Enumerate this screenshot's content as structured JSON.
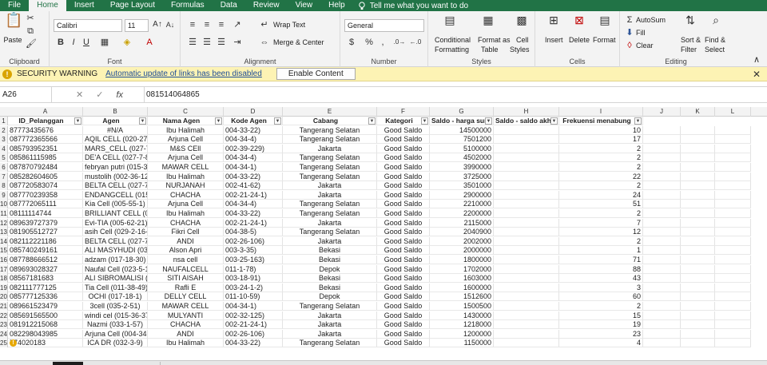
{
  "menu": {
    "tabs": [
      "File",
      "Home",
      "Insert",
      "Page Layout",
      "Formulas",
      "Data",
      "Review",
      "View",
      "Help"
    ],
    "tell_me": "Tell me what you want to do"
  },
  "ribbon": {
    "clipboard": {
      "paste": "Paste",
      "label": "Clipboard"
    },
    "font": {
      "name": "Calibri",
      "size": "11",
      "label": "Font"
    },
    "alignment": {
      "wrap": "Wrap Text",
      "merge": "Merge & Center",
      "label": "Alignment"
    },
    "number": {
      "format": "General",
      "label": "Number"
    },
    "styles": {
      "conditional_1": "Conditional",
      "conditional_2": "Formatting",
      "format_table_1": "Format as",
      "format_table_2": "Table",
      "cell_styles_1": "Cell",
      "cell_styles_2": "Styles",
      "label": "Styles"
    },
    "cells": {
      "insert": "Insert",
      "delete": "Delete",
      "format": "Format",
      "label": "Cells"
    },
    "editing": {
      "autosum": "AutoSum",
      "fill": "Fill",
      "clear": "Clear",
      "sort_1": "Sort &",
      "sort_2": "Filter",
      "find_1": "Find &",
      "find_2": "Select",
      "label": "Editing"
    }
  },
  "security": {
    "title": "SECURITY WARNING",
    "message": "Automatic update of links has been disabled",
    "button": "Enable Content"
  },
  "formula_bar": {
    "name_box": "A26",
    "fx": "fx",
    "value": "081514064865"
  },
  "grid": {
    "columns": [
      "A",
      "B",
      "C",
      "D",
      "E",
      "F",
      "G",
      "H",
      "I",
      "J",
      "K",
      "L"
    ],
    "headers": [
      "ID_Pelanggan",
      "Agen",
      "Nama Agen",
      "Kode Agen",
      "Cabang",
      "Kategori",
      "Saldo - harga sum",
      "Saldo - saldo akhir",
      "Frekuensi menabung"
    ],
    "rows": [
      {
        "n": "2",
        "a": "87773435676",
        "b": "#N/A",
        "c": "Ibu Halimah",
        "d": "004-33-22)",
        "e": "Tangerang Selatan",
        "f": "Good Saldo",
        "g": "14500000",
        "i": "10"
      },
      {
        "n": "3",
        "a": "087772365566",
        "b": "AQIL CELL (020-27-3)",
        "c": "Arjuna Cell",
        "d": "004-34-4)",
        "e": "Tangerang Selatan",
        "f": "Good Saldo",
        "g": "7501200",
        "i": "17"
      },
      {
        "n": "4",
        "a": "085793952351",
        "b": "MARS_CELL (027-7-15)",
        "c": "M&S CEll",
        "d": "002-39-229)",
        "e": "Jakarta",
        "f": "Good Saldo",
        "g": "5100000",
        "i": "2"
      },
      {
        "n": "5",
        "a": "085861115985",
        "b": "DE'A CELL (027-7-8)",
        "c": "Arjuna Cell",
        "d": "004-34-4)",
        "e": "Tangerang Selatan",
        "f": "Good Saldo",
        "g": "4502000",
        "i": "2"
      },
      {
        "n": "6",
        "a": "087870792484",
        "b": "febryan putri (015-38-22",
        "c": "MAWAR CELL",
        "d": "004-34-1)",
        "e": "Tangerang Selatan",
        "f": "Good Saldo",
        "g": "3990000",
        "i": "2"
      },
      {
        "n": "7",
        "a": "085282604605",
        "b": "mustolih (002-36-126)",
        "c": "Ibu Halimah",
        "d": "004-33-22)",
        "e": "Tangerang Selatan",
        "f": "Good Saldo",
        "g": "3725000",
        "i": "22"
      },
      {
        "n": "8",
        "a": "087720583074",
        "b": "BELTA CELL (027-7-12)",
        "c": "NURJANAH",
        "d": "002-41-62)",
        "e": "Jakarta",
        "f": "Good Saldo",
        "g": "3501000",
        "i": "2"
      },
      {
        "n": "9",
        "a": "087770239358",
        "b": "ENDANGCELL (015-25-1)",
        "c": "CHACHA",
        "d": "002-21-24-1)",
        "e": "Jakarta",
        "f": "Good Saldo",
        "g": "2900000",
        "i": "24"
      },
      {
        "n": "10",
        "a": "087772065111",
        "b": "Kia Cell (005-55-1)",
        "c": "Arjuna Cell",
        "d": "004-34-4)",
        "e": "Tangerang Selatan",
        "f": "Good Saldo",
        "g": "2210000",
        "i": "51"
      },
      {
        "n": "11",
        "a": "08111114744",
        "b": "BRILLIANT CELL (027-3-92",
        "c": "Ibu Halimah",
        "d": "004-33-22)",
        "e": "Tangerang Selatan",
        "f": "Good Saldo",
        "g": "2200000",
        "i": "2"
      },
      {
        "n": "12",
        "a": "089639727379",
        "b": "Evi-TIA (005-62-21)",
        "c": "CHACHA",
        "d": "002-21-24-1)",
        "e": "Jakarta",
        "f": "Good Saldo",
        "g": "2115000",
        "i": "7"
      },
      {
        "n": "13",
        "a": "081905512727",
        "b": "asih Cell (029-2-16-3)",
        "c": "Fikri Cell",
        "d": "004-38-5)",
        "e": "Tangerang Selatan",
        "f": "Good Saldo",
        "g": "2040900",
        "i": "12"
      },
      {
        "n": "14",
        "a": "082112221186",
        "b": "BELTA CELL (027-7-12)",
        "c": "ANDI",
        "d": "002-26-106)",
        "e": "Jakarta",
        "f": "Good Saldo",
        "g": "2002000",
        "i": "2"
      },
      {
        "n": "15",
        "a": "085740249161",
        "b": "ALI MASYHUDI (030-7-1)",
        "c": "Alson Apri",
        "d": "003-3-35)",
        "e": "Bekasi",
        "f": "Good Saldo",
        "g": "2000000",
        "i": "1"
      },
      {
        "n": "16",
        "a": "087788666512",
        "b": "adzam (017-18-30)",
        "c": "nsa cell",
        "d": "003-25-163)",
        "e": "Bekasi",
        "f": "Good Saldo",
        "g": "1800000",
        "i": "71"
      },
      {
        "n": "17",
        "a": "089693028327",
        "b": "Naufal Cell (023-5-17)",
        "c": "NAUFALCELL",
        "d": "011-1-78)",
        "e": "Depok",
        "f": "Good Saldo",
        "g": "1702000",
        "i": "88"
      },
      {
        "n": "18",
        "a": "08567181683",
        "b": "ALI SIBROMALISI (015-36",
        "c": "SITI AISAH",
        "d": "003-18-91)",
        "e": "Bekasi",
        "f": "Good Saldo",
        "g": "1603000",
        "i": "43"
      },
      {
        "n": "19",
        "a": "082111777125",
        "b": "Tia Cell (011-38-49)",
        "c": "Rafli E",
        "d": "003-24-1-2)",
        "e": "Bekasi",
        "f": "Good Saldo",
        "g": "1600000",
        "i": "3"
      },
      {
        "n": "20",
        "a": "085777125336",
        "b": "OCHI (017-18-1)",
        "c": "DELLY CELL",
        "d": "011-10-59)",
        "e": "Depok",
        "f": "Good Saldo",
        "g": "1512600",
        "i": "60"
      },
      {
        "n": "21",
        "a": "089661523479",
        "b": "3cell (035-2-51)",
        "c": "MAWAR CELL",
        "d": "004-34-1)",
        "e": "Tangerang Selatan",
        "f": "Good Saldo",
        "g": "1500500",
        "i": "2"
      },
      {
        "n": "22",
        "a": "085691565500",
        "b": "windi cel (015-36-37-1)",
        "c": "MULYANTI",
        "d": "002-32-125)",
        "e": "Jakarta",
        "f": "Good Saldo",
        "g": "1430000",
        "i": "15"
      },
      {
        "n": "23",
        "a": "081912215068",
        "b": "Nazmi (033-1-57)",
        "c": "CHACHA",
        "d": "002-21-24-1)",
        "e": "Jakarta",
        "f": "Good Saldo",
        "g": "1218000",
        "i": "19"
      },
      {
        "n": "24",
        "a": "082298043985",
        "b": "Arjuna Cell (004-34-4)",
        "c": "ANDI",
        "d": "002-26-106)",
        "e": "Jakarta",
        "f": "Good Saldo",
        "g": "1200000",
        "i": "23"
      },
      {
        "n": "25",
        "a": "774020183",
        "b": "ICA DR (032-3-9)",
        "c": "Ibu Halimah",
        "d": "004-33-22)",
        "e": "Tangerang Selatan",
        "f": "Good Saldo",
        "g": "1150000",
        "i": "4"
      }
    ]
  },
  "colors": {
    "excel_green": "#217346",
    "warning_bg": "#fdf3b4",
    "link": "#1f4e96"
  }
}
